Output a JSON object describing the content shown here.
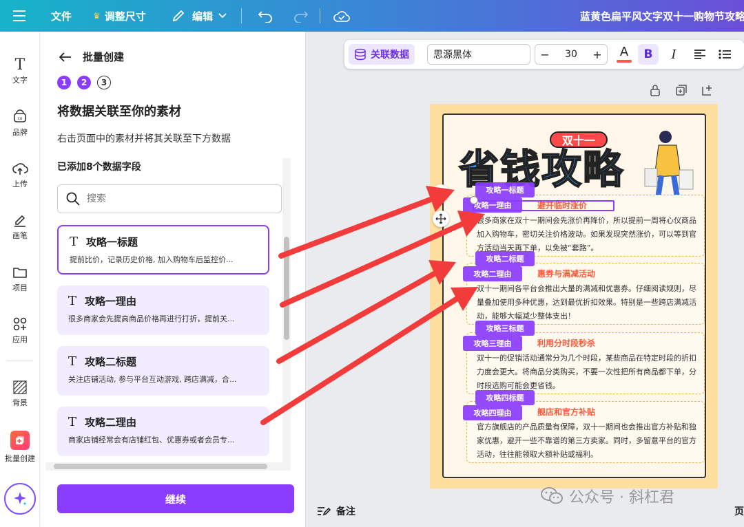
{
  "topbar": {
    "file": "文件",
    "resize": "调整尺寸",
    "edit": "编辑",
    "doc_title": "蓝黄色扁平风文字双十一购物节攻略"
  },
  "rail": {
    "text": "文字",
    "brand": "品牌",
    "upload": "上传",
    "draw": "画笔",
    "projects": "项目",
    "apps": "应用",
    "background": "背景",
    "batch": "批量创建"
  },
  "panel": {
    "title": "批量创建",
    "steps": [
      "1",
      "2",
      "3"
    ],
    "heading": "将数据关联至你的素材",
    "desc": "右击页面中的素材并将其关联至下方数据",
    "count": "已添加8个数据字段",
    "search_placeholder": "搜索",
    "cards": [
      {
        "title": "攻略一标题",
        "desc": "提前比价，记录历史价格, 加入购物车后监控价..."
      },
      {
        "title": "攻略一理由",
        "desc": "很多商家会先提高商品价格再进行打折，提前关..."
      },
      {
        "title": "攻略二标题",
        "desc": "关注店铺活动, 参与平台互动游戏, 跨店满减，合..."
      },
      {
        "title": "攻略二理由",
        "desc": "商家店铺经常会有店铺红包、优惠券或者会员专..."
      }
    ],
    "continue": "继续"
  },
  "toolbar": {
    "linked_data": "关联数据",
    "font": "思源黑体",
    "minus": "−",
    "font_size": "30",
    "plus": "+",
    "text_color_glyph": "A",
    "bold_glyph": "B",
    "italic_glyph": "I"
  },
  "poster": {
    "badge": "双十一",
    "headline": "省钱攻略",
    "sections": [
      {
        "title": "避开临时涨价",
        "body": "很多商家在双十一期间会先涨价再降价，所以提前一周将心仪商品加入购物车，密切关注价格波动。如果发现突然涨价，可以等到官方活动当天再下单，以免被“套路”。"
      },
      {
        "title": "惠券与满减活动",
        "body": "双十一期间各平台会推出大量的满减和优惠券。仔细阅读规则，尽量叠加使用多种优惠，达到最优折扣效果。特别是一些跨店满减活动，能够大幅减少整体支出！"
      },
      {
        "title": "利用分时段秒杀",
        "body": "双十一的促销活动通常分为几个时段，某些商品在特定时段的折扣力度会更大。将商品分类购买，不要一次性把所有商品都下单，分时段选购可能会更省钱。"
      },
      {
        "title": "舰店和官方补贴",
        "body": "官方旗舰店的产品质量有保障，双十一期间也会推出官方补贴和独家优惠，避开一些不靠谱的第三方卖家。同时，多留意平台的官方活动，往往能领取大额补贴或福利。"
      }
    ],
    "tags": [
      {
        "title": "攻略一标题",
        "reason": "攻略一理由"
      },
      {
        "title": "攻略二标题",
        "reason": "攻略二理由"
      },
      {
        "title": "攻略三标题",
        "reason": "攻略三理由"
      },
      {
        "title": "攻略四标题",
        "reason": "攻略四理由"
      }
    ]
  },
  "footer": {
    "notes": "备注",
    "page": "页"
  },
  "watermark": {
    "text": "公众号 · 斜杠君"
  },
  "colors": {
    "accent": "#8b3dff",
    "arrow": "#f23b3b"
  }
}
